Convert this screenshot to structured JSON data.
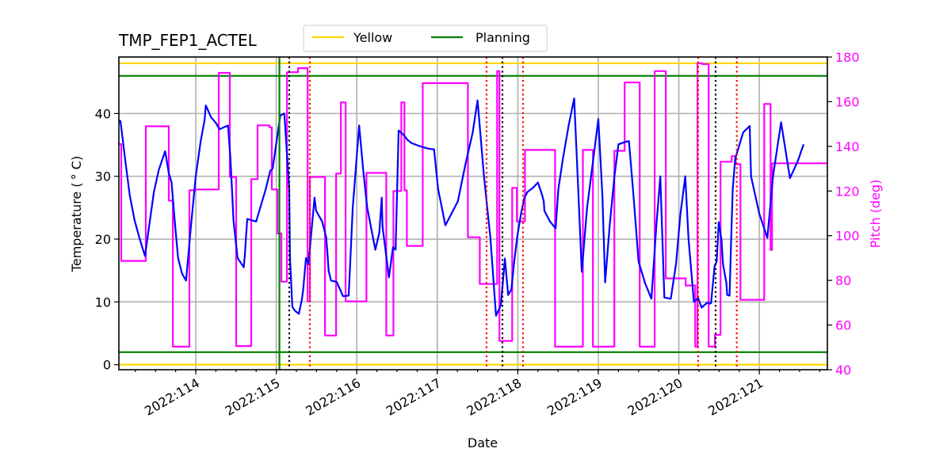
{
  "chart_data": {
    "type": "line",
    "title": "TMP_FEP1_ACTEL",
    "xlabel": "Date",
    "ylabel": "Temperature ($^\\circ$C)",
    "ylabel_display": "Temperature ( ° C)",
    "y2label": "Pitch (deg)",
    "xlim": [
      113.045,
      121.845
    ],
    "ylim": [
      -0.8,
      49
    ],
    "y2lim": [
      40,
      180
    ],
    "grid": true,
    "x_ticks": [
      114,
      115,
      116,
      117,
      118,
      119,
      120,
      121
    ],
    "x_tick_labels": [
      "2022:114",
      "2022:115",
      "2022:116",
      "2022:117",
      "2022:118",
      "2022:119",
      "2022:120",
      "2022:121"
    ],
    "x_minor_tick_step": 0.25,
    "y_ticks": [
      0,
      10,
      20,
      30,
      40
    ],
    "y_tick_labels": [
      "0",
      "10",
      "20",
      "30",
      "40"
    ],
    "y2_ticks": [
      40,
      60,
      80,
      100,
      120,
      140,
      160,
      180
    ],
    "y2_tick_labels": [
      "40",
      "60",
      "80",
      "100",
      "120",
      "140",
      "160",
      "180"
    ],
    "legend": {
      "placement": "top-center-above",
      "entries": [
        {
          "label": "Yellow",
          "color": "#ffd700"
        },
        {
          "label": "Planning",
          "color": "#008000"
        }
      ]
    },
    "hlines": [
      {
        "name": "yellow-high",
        "y": 48,
        "color": "#ffd700"
      },
      {
        "name": "planning-high",
        "y": 46,
        "color": "#008000"
      },
      {
        "name": "planning-low",
        "y": 2,
        "color": "#008000"
      },
      {
        "name": "yellow-low",
        "y": 0,
        "color": "#ffd700"
      }
    ],
    "vlines": [
      {
        "name": "now-line",
        "x": 115.039,
        "color": "#008000",
        "style": "solid"
      },
      {
        "name": "black-dotted",
        "x": 115.161,
        "color": "#000000",
        "style": "dotted"
      },
      {
        "name": "red-dotted",
        "x": 115.417,
        "color": "#ff0000",
        "style": "dotted"
      },
      {
        "name": "red-dotted",
        "x": 117.612,
        "color": "#ff0000",
        "style": "dotted"
      },
      {
        "name": "black-dotted",
        "x": 117.809,
        "color": "#000000",
        "style": "dotted"
      },
      {
        "name": "red-dotted",
        "x": 118.065,
        "color": "#ff0000",
        "style": "dotted"
      },
      {
        "name": "red-dotted",
        "x": 120.24,
        "color": "#ff0000",
        "style": "dotted"
      },
      {
        "name": "black-dotted",
        "x": 120.457,
        "color": "#000000",
        "style": "dotted"
      },
      {
        "name": "red-dotted",
        "x": 120.72,
        "color": "#ff0000",
        "style": "dotted"
      }
    ],
    "series": [
      {
        "name": "Temperature",
        "axis": "left",
        "color": "#0000ff",
        "x": [
          113.045,
          113.065,
          113.12,
          113.18,
          113.24,
          113.3,
          113.37,
          113.42,
          113.48,
          113.54,
          113.62,
          113.665,
          113.7,
          113.745,
          113.78,
          113.83,
          113.88,
          113.94,
          114.0,
          114.06,
          114.11,
          114.125,
          114.19,
          114.25,
          114.295,
          114.35,
          114.4,
          114.43,
          114.45,
          114.468,
          114.52,
          114.596,
          114.61,
          114.625,
          114.64,
          114.75,
          114.87,
          114.925,
          114.955,
          115.02,
          115.05,
          115.1,
          115.16,
          115.17,
          115.2,
          115.23,
          115.28,
          115.32,
          115.335,
          115.369,
          115.4,
          115.475,
          115.495,
          115.57,
          115.62,
          115.64,
          115.65,
          115.68,
          115.75,
          115.83,
          115.9,
          115.95,
          116.03,
          116.08,
          116.13,
          116.23,
          116.28,
          116.31,
          116.32,
          116.4,
          116.45,
          116.482,
          116.52,
          116.59,
          116.63,
          116.68,
          116.78,
          116.89,
          116.96,
          117.01,
          117.1,
          117.255,
          117.35,
          117.44,
          117.5,
          117.58,
          117.66,
          117.729,
          117.79,
          117.84,
          117.88,
          117.92,
          117.955,
          117.994,
          118.04,
          118.08,
          118.12,
          118.19,
          118.25,
          118.3,
          118.323,
          118.33,
          118.4,
          118.47,
          118.504,
          118.56,
          118.63,
          118.7,
          118.75,
          118.795,
          118.86,
          118.94,
          119.0,
          119.05,
          119.085,
          119.14,
          119.2,
          119.25,
          119.34,
          119.38,
          119.43,
          119.5,
          119.58,
          119.66,
          119.72,
          119.77,
          119.82,
          119.9,
          119.965,
          120.02,
          120.08,
          120.12,
          120.187,
          120.24,
          120.283,
          120.355,
          120.38,
          120.4,
          120.445,
          120.47,
          120.496,
          120.53,
          120.549,
          120.591,
          120.6,
          120.63,
          120.65,
          120.67,
          120.7,
          120.8,
          120.88,
          120.897,
          121.0,
          121.1,
          121.17,
          121.27,
          121.38,
          121.48,
          121.55,
          121.6,
          121.66,
          121.731,
          121.81,
          121.845
        ],
        "y": [
          38.9,
          38.8,
          33.0,
          27.0,
          23.0,
          20.2,
          17.3,
          22.0,
          27.5,
          31.0,
          34.0,
          30.5,
          29.0,
          22.0,
          17.0,
          14.5,
          13.4,
          22.0,
          30.0,
          35.5,
          39.0,
          41.3,
          39.4,
          38.5,
          37.5,
          37.8,
          38.1,
          33.0,
          28.0,
          23.0,
          17.0,
          15.5,
          17.5,
          20.5,
          23.2,
          22.8,
          28.0,
          30.9,
          31.2,
          37.0,
          39.7,
          40.0,
          28.0,
          17.0,
          9.2,
          8.6,
          8.1,
          10.5,
          12.0,
          17.0,
          16.0,
          26.6,
          24.5,
          22.8,
          20.3,
          17.0,
          15.0,
          13.4,
          13.2,
          10.9,
          11.0,
          25.0,
          38.1,
          31.0,
          25.0,
          18.3,
          21.0,
          26.6,
          22.0,
          13.9,
          18.7,
          18.3,
          37.3,
          36.5,
          35.8,
          35.3,
          34.8,
          34.4,
          34.3,
          28.0,
          22.2,
          26.0,
          31.9,
          37.0,
          42.1,
          30.0,
          20.2,
          7.8,
          9.5,
          16.9,
          11.1,
          12.0,
          16.4,
          20.5,
          24.0,
          26.5,
          27.5,
          28.2,
          29.0,
          27.1,
          26.0,
          24.5,
          22.8,
          21.7,
          28.0,
          32.8,
          38.0,
          42.4,
          28.0,
          14.8,
          25.0,
          33.0,
          39.1,
          27.0,
          13.1,
          22.0,
          30.0,
          35.1,
          35.5,
          35.6,
          28.0,
          16.4,
          13.0,
          10.5,
          22.0,
          30.0,
          10.7,
          10.5,
          16.0,
          24.0,
          30.0,
          20.0,
          10.0,
          10.6,
          9.1,
          9.9,
          9.7,
          9.8,
          15.8,
          16.4,
          22.7,
          19.9,
          16.0,
          13.0,
          11.1,
          11.0,
          20.0,
          28.0,
          32.8,
          37.0,
          38.0,
          30.0,
          24.0,
          20.2,
          30.0,
          38.6,
          29.7,
          32.5,
          35.1
        ]
      },
      {
        "name": "Pitch",
        "axis": "right",
        "color": "#ff00ff",
        "step": true,
        "x": [
          113.045,
          113.075,
          113.38,
          113.665,
          113.715,
          113.921,
          114.0,
          114.285,
          114.423,
          114.502,
          114.689,
          114.768,
          114.915,
          114.945,
          115.014,
          115.034,
          115.064,
          115.133,
          115.271,
          115.389,
          115.418,
          115.605,
          115.743,
          115.802,
          115.861,
          116.12,
          116.366,
          116.455,
          116.553,
          116.592,
          116.622,
          116.819,
          117.38,
          117.528,
          117.743,
          117.772,
          117.93,
          117.988,
          118.089,
          118.463,
          118.808,
          118.933,
          119.199,
          119.327,
          119.514,
          119.7,
          119.838,
          120.085,
          120.203,
          120.232,
          120.291,
          120.37,
          120.449,
          120.518,
          120.657,
          120.706,
          120.765,
          121.06,
          121.139,
          121.158,
          121.365,
          121.513,
          121.601,
          121.845
        ],
        "y": [
          141,
          88.7,
          149,
          115.7,
          50.3,
          120.3,
          120.7,
          172.9,
          126.3,
          50.6,
          125.3,
          149.4,
          148.5,
          120.7,
          101,
          101,
          79.4,
          173.2,
          175,
          70.6,
          126.3,
          55.3,
          127.8,
          159.7,
          70.6,
          128.1,
          55.3,
          120,
          159.7,
          120.3,
          95.4,
          168.3,
          99.3,
          78.4,
          173.7,
          52.9,
          121.4,
          106.4,
          138.4,
          50.3,
          138.4,
          50.3,
          138,
          168.6,
          50.3,
          173.7,
          80.9,
          77.7,
          50.3,
          177.2,
          176.8,
          50.3,
          55.6,
          133.1,
          135.6,
          132,
          71.3,
          159,
          93.6,
          132.4,
          132.4,
          132.4,
          132.4,
          132.4
        ]
      }
    ]
  }
}
